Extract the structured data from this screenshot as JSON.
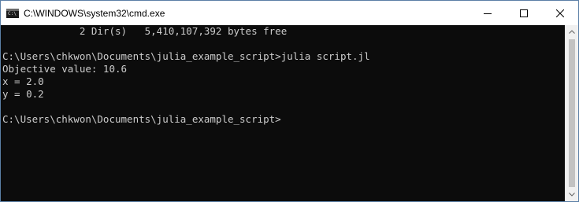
{
  "window": {
    "title": "C:\\WINDOWS\\system32\\cmd.exe",
    "icon": "cmd-icon",
    "icon_label": "C:\\"
  },
  "controls": {
    "minimize_icon": "minimize-icon",
    "maximize_icon": "maximize-icon",
    "close_icon": "close-icon"
  },
  "console": {
    "lines": [
      "             2 Dir(s)   5,410,107,392 bytes free",
      "",
      "C:\\Users\\chkwon\\Documents\\julia_example_script>julia script.jl",
      "Objective value: 10.6",
      "x = 2.0",
      "y = 0.2",
      "",
      "C:\\Users\\chkwon\\Documents\\julia_example_script>"
    ]
  },
  "colors": {
    "console_background": "#0c0c0c",
    "console_text": "#cccccc",
    "titlebar_background": "#ffffff"
  }
}
